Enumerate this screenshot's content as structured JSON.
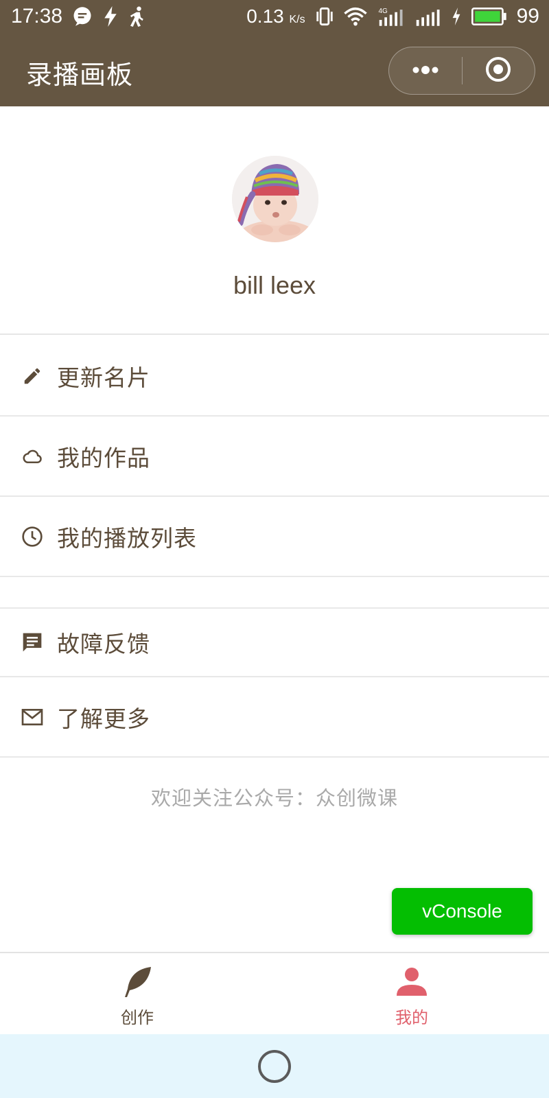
{
  "status_bar": {
    "time": "17:38",
    "net_speed": "0.13",
    "net_unit": "K/s",
    "battery": "99",
    "icons": [
      "message-icon",
      "flash-icon",
      "walk-icon",
      "vibrate-icon",
      "wifi-icon",
      "signal-4g-icon",
      "signal-icon",
      "charging-icon",
      "battery-icon"
    ]
  },
  "title_bar": {
    "title": "录播画板",
    "menu_icon": "more-dots-icon",
    "close_icon": "target-circle-icon"
  },
  "profile": {
    "name": "bill leex"
  },
  "menu": {
    "items": [
      {
        "label": "更新名片",
        "icon": "pencil-icon"
      },
      {
        "label": "我的作品",
        "icon": "cloud-icon"
      },
      {
        "label": "我的播放列表",
        "icon": "clock-icon"
      },
      {
        "label": "故障反馈",
        "icon": "feedback-icon"
      },
      {
        "label": "了解更多",
        "icon": "mail-icon"
      }
    ]
  },
  "footer_note": "欢迎关注公众号：众创微课",
  "vconsole": {
    "label": "vConsole"
  },
  "tab_bar": {
    "tabs": [
      {
        "label": "创作",
        "icon": "feather-icon",
        "active": false
      },
      {
        "label": "我的",
        "icon": "person-icon",
        "active": true
      }
    ]
  },
  "colors": {
    "header_bg": "#655642",
    "text_brown": "#5c4c3a",
    "active_tab": "#e0606c",
    "vconsole_green": "#04be02",
    "nav_bg": "#e5f6fd"
  }
}
